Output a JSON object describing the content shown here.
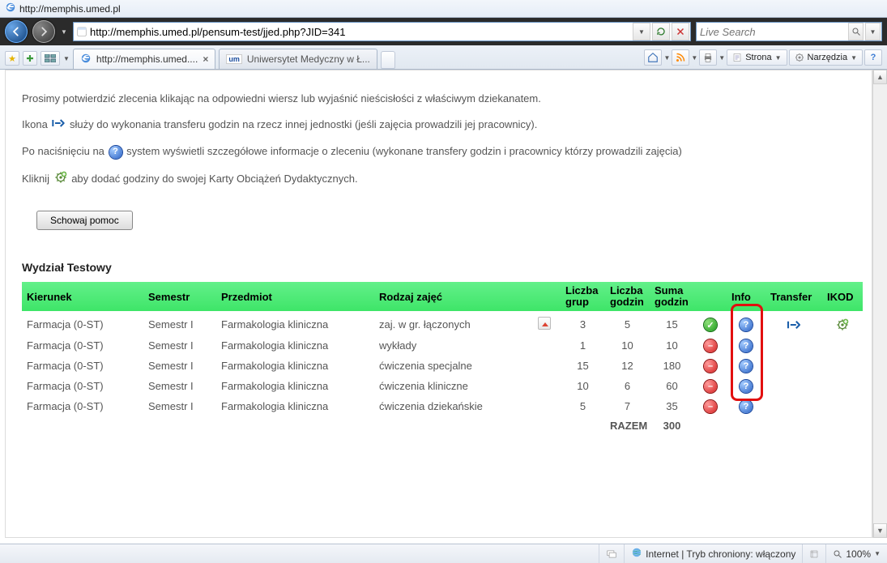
{
  "caption": "http://memphis.umed.pl",
  "nav": {
    "address": "http://memphis.umed.pl/pensum-test/jjed.php?JID=341",
    "search_placeholder": "Live Search"
  },
  "tabs": [
    {
      "label": "http://memphis.umed....",
      "active": true
    },
    {
      "label": "Uniwersytet Medyczny w Ł...",
      "active": false
    }
  ],
  "toolbar": {
    "strona": "Strona",
    "narzedzia": "Narzędzia"
  },
  "content": {
    "p1": "Prosimy potwierdzić zlecenia klikając na odpowiedni wiersz lub wyjaśnić nieścisłości z właściwym dziekanatem.",
    "p2a": "Ikona ",
    "p2b": " służy do wykonania transferu godzin na rzecz innej jednostki (jeśli zajęcia prowadzili jej pracownicy).",
    "p3a": "Po naciśnięciu na ",
    "p3b": " system wyświetli szczegółowe informacje o zleceniu (wykonane transfery godzin i pracownicy którzy prowadzili zajęcia)",
    "p4a": "Kliknij ",
    "p4b": " aby dodać godziny do swojej Karty Obciążeń Dydaktycznych.",
    "hide_help": "Schowaj pomoc",
    "section": "Wydział Testowy"
  },
  "headers": {
    "kierunek": "Kierunek",
    "semestr": "Semestr",
    "przedmiot": "Przedmiot",
    "rodzaj": "Rodzaj zajęć",
    "lgrup": "Liczba grup",
    "lgodz": "Liczba godzin",
    "suma": "Suma godzin",
    "info": "Info",
    "transfer": "Transfer",
    "ikod": "IKOD"
  },
  "rows": [
    {
      "kier": "Farmacja (0-ST)",
      "sem": "Semestr I",
      "przed": "Farmakologia kliniczna",
      "rodz": "zaj. w gr. łączonych",
      "tri": true,
      "lg": "3",
      "lh": "5",
      "sum": "15",
      "status": "ok",
      "transfer": true,
      "ikod": true
    },
    {
      "kier": "Farmacja (0-ST)",
      "sem": "Semestr I",
      "przed": "Farmakologia kliniczna",
      "rodz": "wykłady",
      "tri": false,
      "lg": "1",
      "lh": "10",
      "sum": "10",
      "status": "no",
      "transfer": false,
      "ikod": false
    },
    {
      "kier": "Farmacja (0-ST)",
      "sem": "Semestr I",
      "przed": "Farmakologia kliniczna",
      "rodz": "ćwiczenia specjalne",
      "tri": false,
      "lg": "15",
      "lh": "12",
      "sum": "180",
      "status": "no",
      "transfer": false,
      "ikod": false
    },
    {
      "kier": "Farmacja (0-ST)",
      "sem": "Semestr I",
      "przed": "Farmakologia kliniczna",
      "rodz": "ćwiczenia kliniczne",
      "tri": false,
      "lg": "10",
      "lh": "6",
      "sum": "60",
      "status": "no",
      "transfer": false,
      "ikod": false
    },
    {
      "kier": "Farmacja (0-ST)",
      "sem": "Semestr I",
      "przed": "Farmakologia kliniczna",
      "rodz": "ćwiczenia dziekańskie",
      "tri": false,
      "lg": "5",
      "lh": "7",
      "sum": "35",
      "status": "no",
      "transfer": false,
      "ikod": false
    }
  ],
  "total": {
    "label": "RAZEM",
    "value": "300"
  },
  "status": {
    "internet": "Internet | Tryb chroniony: włączony",
    "zoom": "100%"
  }
}
